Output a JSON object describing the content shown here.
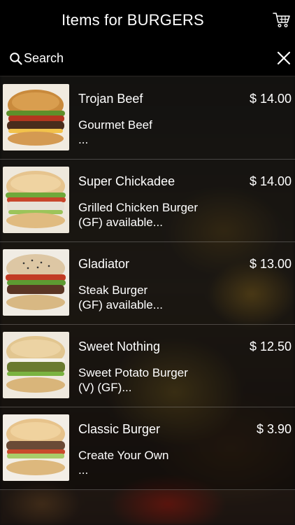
{
  "header": {
    "title": "Items for BURGERS",
    "cart_icon": "cart-icon"
  },
  "search": {
    "label": "Search",
    "search_icon": "search-icon",
    "close_icon": "close-icon"
  },
  "items": [
    {
      "name": "Trojan Beef",
      "price": "$ 14.00",
      "description": "Gourmet Beef\n..."
    },
    {
      "name": "Super Chickadee",
      "price": "$ 14.00",
      "description": "Grilled Chicken Burger\n(GF) available..."
    },
    {
      "name": "Gladiator",
      "price": "$ 13.00",
      "description": "Steak Burger\n(GF) available..."
    },
    {
      "name": "Sweet Nothing",
      "price": "$ 12.50",
      "description": "Sweet Potato Burger\n(V) (GF)..."
    },
    {
      "name": "Classic Burger",
      "price": "$ 3.90",
      "description": "Create Your Own\n..."
    }
  ]
}
